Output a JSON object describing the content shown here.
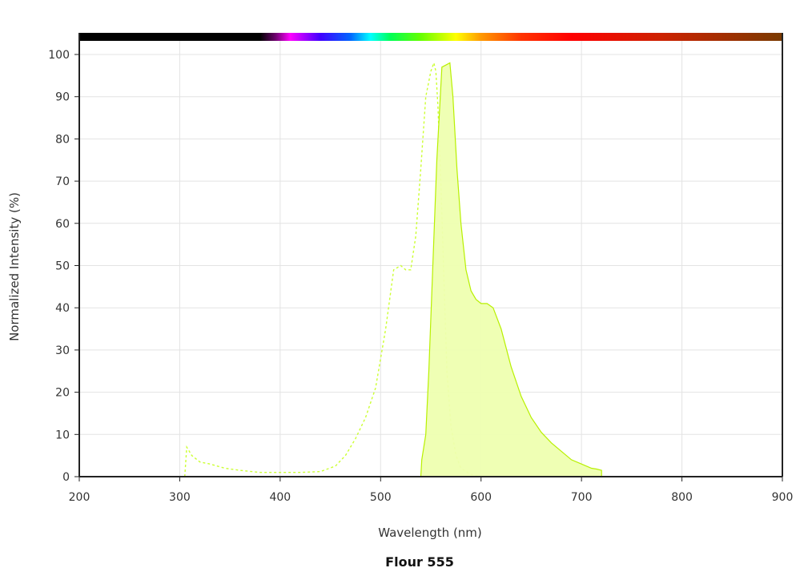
{
  "chart_data": {
    "type": "area",
    "title": "Flour 555",
    "xlabel": "Wavelength (nm)",
    "ylabel": "Normalized Intensity (%)",
    "xlim": [
      200,
      900
    ],
    "ylim": [
      0,
      100
    ],
    "x_ticks": [
      200,
      300,
      400,
      500,
      600,
      700,
      800,
      900
    ],
    "y_ticks": [
      0,
      10,
      20,
      30,
      40,
      50,
      60,
      70,
      80,
      90,
      100
    ],
    "grid": true,
    "colors": {
      "series": "#ccff33",
      "fill": "#eeffb0",
      "emission_stroke": "#b8f000",
      "grid": "#e3e3e3",
      "axis": "#222222"
    },
    "spectrum_bar": [
      {
        "nm": 200,
        "color": "#000000"
      },
      {
        "nm": 380,
        "color": "#000000"
      },
      {
        "nm": 395,
        "color": "#6a006a"
      },
      {
        "nm": 410,
        "color": "#ff00ff"
      },
      {
        "nm": 440,
        "color": "#4000ff"
      },
      {
        "nm": 470,
        "color": "#0066ff"
      },
      {
        "nm": 490,
        "color": "#00ffff"
      },
      {
        "nm": 510,
        "color": "#00ff55"
      },
      {
        "nm": 540,
        "color": "#66ff00"
      },
      {
        "nm": 575,
        "color": "#ffff00"
      },
      {
        "nm": 600,
        "color": "#ff9900"
      },
      {
        "nm": 640,
        "color": "#ff3300"
      },
      {
        "nm": 690,
        "color": "#ff0000"
      },
      {
        "nm": 780,
        "color": "#cc2200"
      },
      {
        "nm": 900,
        "color": "#7a3a00"
      }
    ],
    "series": [
      {
        "style": "dashed",
        "x": [
          305,
          307,
          312,
          320,
          330,
          345,
          360,
          380,
          400,
          420,
          440,
          455,
          465,
          475,
          485,
          495,
          505,
          513,
          520,
          525,
          530,
          535,
          540,
          545,
          550,
          553,
          555,
          557,
          560,
          563,
          566,
          570,
          575,
          580,
          590,
          600
        ],
        "y": [
          0,
          7,
          5,
          3.5,
          3,
          2,
          1.5,
          1,
          1,
          1,
          1.2,
          2.5,
          5,
          9,
          14,
          21,
          35,
          49,
          50,
          49,
          49,
          57,
          73,
          90,
          96,
          98,
          96,
          88,
          70,
          47,
          25,
          12,
          5,
          2,
          0.5,
          0
        ]
      },
      {
        "style": "filled",
        "x": [
          540,
          541,
          545,
          548,
          552,
          556,
          561,
          565,
          569,
          572,
          576,
          580,
          585,
          590,
          595,
          600,
          606,
          612,
          620,
          630,
          640,
          650,
          660,
          670,
          680,
          690,
          700,
          710,
          715,
          720,
          720
        ],
        "y": [
          0,
          4,
          10,
          25,
          50,
          75,
          97,
          97.5,
          98,
          90,
          73,
          60,
          49,
          44,
          42,
          41,
          41,
          40,
          35,
          26,
          19,
          14,
          10.5,
          8,
          6,
          4,
          3,
          2,
          1.8,
          1.5,
          0
        ]
      }
    ]
  }
}
